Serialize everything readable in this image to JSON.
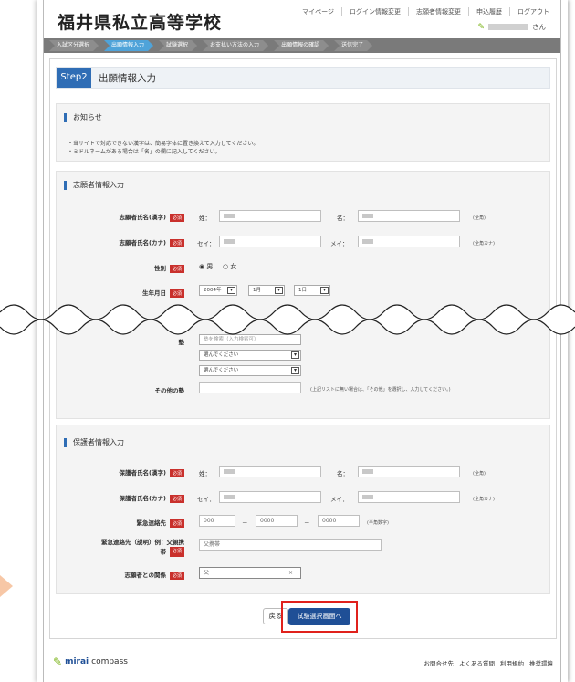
{
  "header": {
    "school_name": "福井県私立高等学校",
    "nav": [
      "マイページ",
      "ログイン情報変更",
      "志願者情報変更",
      "申込履歴",
      "ログアウト"
    ],
    "user_suffix": "さん"
  },
  "steps": [
    "入試区分選択",
    "出願情報入力",
    "試験選択",
    "お支払い方法の入力",
    "出願情報の確認",
    "送信完了"
  ],
  "page": {
    "step_badge": "Step2",
    "step_title": "出願情報入力"
  },
  "notice": {
    "heading": "お知らせ",
    "lines": [
      "・当サイトで対応できない漢字は、簡易字体に置き換えて入力してください。",
      "・ミドルネームがある場合は「名」の欄に記入してください。"
    ]
  },
  "applicant": {
    "heading": "志願者情報入力",
    "required": "必須",
    "name_kanji_label": "志願者氏名(漢字)",
    "name_kana_label": "志願者氏名(カナ)",
    "sei": "姓：",
    "mei": "名：",
    "sei_kana": "セイ：",
    "mei_kana": "メイ：",
    "hint_full": "(全角)",
    "hint_kana": "(全角カナ)",
    "gender_label": "性別",
    "gender_male": "◉ 男",
    "gender_female": "○ 女",
    "birth_label": "生年月日",
    "birth_year": "2004年",
    "birth_month": "1月",
    "birth_day": "1日",
    "juku_label": "塾",
    "juku_search_placeholder": "塾を検索（入力検索可）",
    "juku_select_1": "選んでください",
    "juku_select_2": "選んでください",
    "other_juku_label": "その他の塾",
    "other_juku_hint": "(上記リストに無い場合は、「その他」を選択し、入力してください。)"
  },
  "guardian": {
    "heading": "保護者情報入力",
    "name_kanji_label": "保護者氏名(漢字)",
    "name_kana_label": "保護者氏名(カナ)",
    "sei": "姓：",
    "mei": "名：",
    "sei_kana": "セイ：",
    "mei_kana": "メイ：",
    "hint_full": "(全角)",
    "hint_kana": "(全角カナ)",
    "emergency_label": "緊急連絡先",
    "phone_1": "000",
    "phone_2": "0000",
    "phone_3": "0000",
    "dash": "－",
    "phone_hint": "(半角数字)",
    "emergency_desc_label_1": "緊急連絡先（説明）例：父親携",
    "emergency_desc_label_2": "帯",
    "emergency_desc_value": "父携帯",
    "relation_label": "志願者との関係",
    "relation_value": "父",
    "relation_clear": "×"
  },
  "buttons": {
    "back": "戻る",
    "next": "試験選択画面へ"
  },
  "footer": {
    "logo_bold": "mirai",
    "logo_rest": "compass",
    "links": [
      "お問合せ先",
      "よくある質問",
      "利用規約",
      "推奨環境"
    ]
  },
  "colors": {
    "primary": "#1f4f96",
    "step_active": "#4fa3d9",
    "required": "#c9302c",
    "highlight": "#e0211c"
  }
}
